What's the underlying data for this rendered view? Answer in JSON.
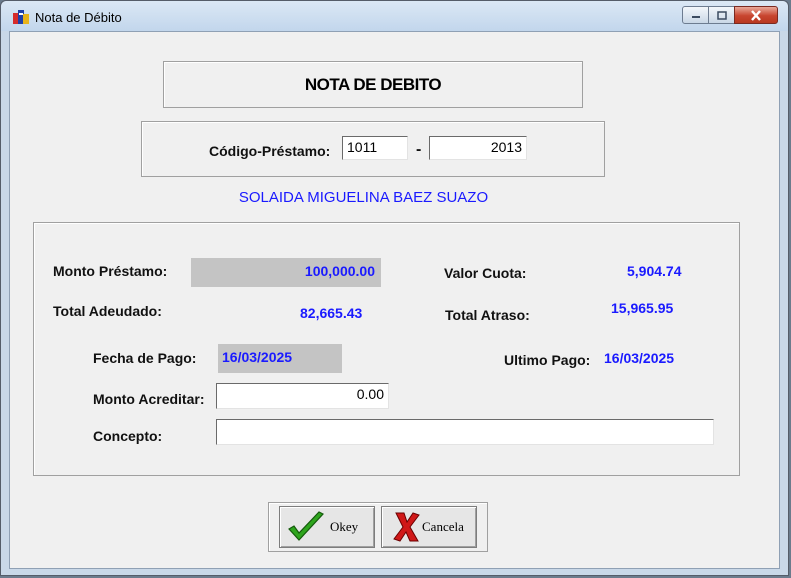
{
  "window": {
    "title": "Nota de Débito"
  },
  "header": {
    "title": "NOTA DE DEBITO"
  },
  "loan_code": {
    "label": "Código-Préstamo:",
    "part1": "1011",
    "separator": "-",
    "part2": "2013"
  },
  "client_name": "SOLAIDA MIGUELINA BAEZ SUAZO",
  "details": {
    "monto_prestamo_label": "Monto Préstamo:",
    "monto_prestamo": "100,000.00",
    "valor_cuota_label": "Valor Cuota:",
    "valor_cuota": "5,904.74",
    "total_adeudado_label": "Total Adeudado:",
    "total_adeudado": "82,665.43",
    "total_atraso_label": "Total Atraso:",
    "total_atraso": "15,965.95",
    "fecha_pago_label": "Fecha de Pago:",
    "fecha_pago": "16/03/2025",
    "ultimo_pago_label": "Ultimo Pago:",
    "ultimo_pago": "16/03/2025",
    "monto_acreditar_label": "Monto Acreditar:",
    "monto_acreditar": "0.00",
    "concepto_label": "Concepto:",
    "concepto": ""
  },
  "buttons": {
    "ok": "Okey",
    "cancel": "Cancela"
  }
}
